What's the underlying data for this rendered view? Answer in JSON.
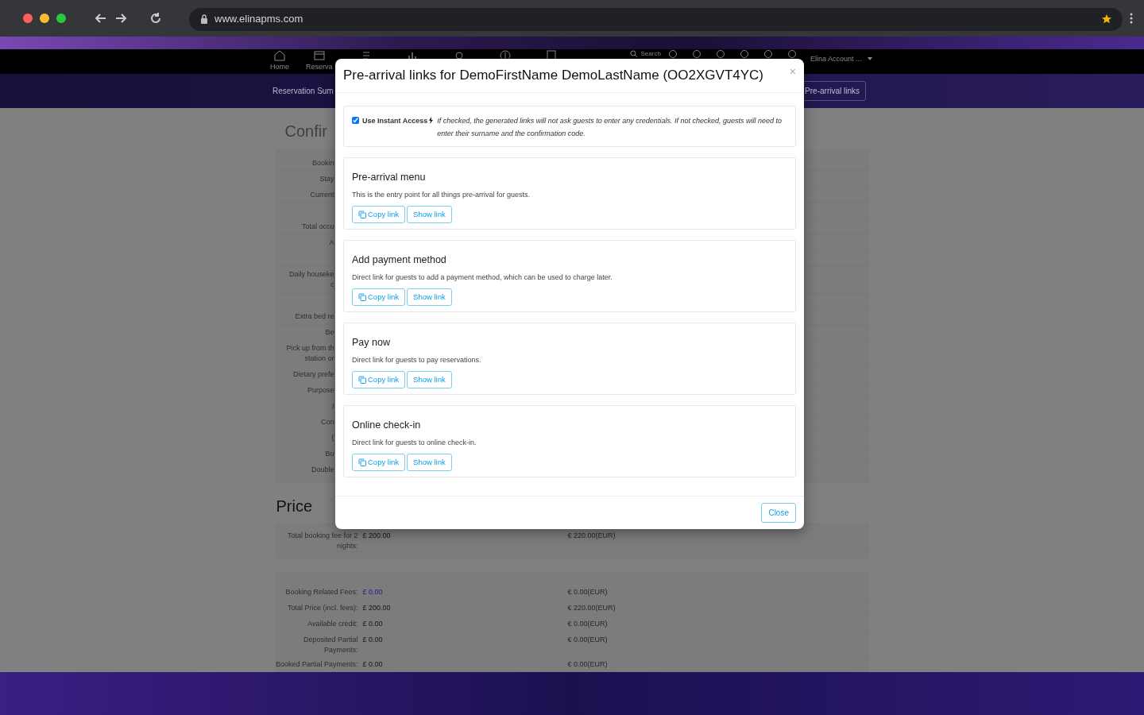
{
  "browser": {
    "url": "www.elinapms.com"
  },
  "navbar": {
    "items": [
      {
        "kind": "labeled",
        "label": "Home"
      },
      {
        "kind": "labeled",
        "label": "Reserva"
      },
      {
        "kind": "icon"
      },
      {
        "kind": "icon"
      },
      {
        "kind": "icon"
      },
      {
        "kind": "icon"
      },
      {
        "kind": "icon"
      }
    ],
    "search": {
      "placeholder": "Search"
    },
    "account": "Elina Account ..."
  },
  "subnav": {
    "title": "Reservation Sum",
    "button": "Pre-arrival links"
  },
  "confirmation": {
    "heading": "Confir",
    "rows": [
      {
        "kind": "label",
        "label": "Bookin"
      },
      {
        "kind": "label",
        "label": "Stay"
      },
      {
        "kind": "label",
        "label": "Current"
      },
      {
        "kind": "empty"
      },
      {
        "kind": "label",
        "label": "Total occu"
      },
      {
        "kind": "label",
        "label": "A"
      },
      {
        "kind": "empty"
      },
      {
        "kind": "label",
        "label": "Daily houseke\nc"
      },
      {
        "kind": "empty"
      },
      {
        "kind": "label",
        "label": "Extra bed re"
      },
      {
        "kind": "label",
        "label": "Be"
      },
      {
        "kind": "label",
        "label": "Pick up from th\nstation or"
      },
      {
        "kind": "label",
        "label": "Dietary prefe"
      },
      {
        "kind": "label",
        "label": "Purpose"
      },
      {
        "kind": "label",
        "label": "I"
      },
      {
        "kind": "label",
        "label": "Con"
      },
      {
        "kind": "label",
        "label": "("
      },
      {
        "kind": "label",
        "label": "Bu"
      },
      {
        "kind": "label",
        "label": "Double"
      }
    ]
  },
  "price": {
    "heading": "Price",
    "groups": [
      [
        {
          "label": "Total booking fee for 2 nights:",
          "gbp": "£ 200.00",
          "eur": "€ 220.00(EUR)",
          "linked": false
        }
      ],
      [
        {
          "label": "Booking Related Fees:",
          "gbp": "£ 0.00",
          "eur": "€ 0.00(EUR)",
          "linked": true
        },
        {
          "label": "Total Price (incl. fees):",
          "gbp": "£ 200.00",
          "eur": "€ 220.00(EUR)",
          "linked": false
        },
        {
          "label": "Available credit:",
          "gbp": "£ 0.00",
          "eur": "€ 0.00(EUR)",
          "linked": false
        },
        {
          "label": "Deposited Partial Payments:",
          "gbp": "£ 0.00",
          "eur": "€ 0.00(EUR)",
          "linked": false
        },
        {
          "label": "Booked Partial Payments:",
          "gbp": "£ 0.00",
          "eur": "€ 0.00(EUR)",
          "linked": false
        }
      ]
    ]
  },
  "modal": {
    "title": "Pre-arrival links for DemoFirstName DemoLastName (OO2XGVT4YC)",
    "close_symbol": "×",
    "instant_access": {
      "checked": true,
      "label": "Use Instant Access",
      "hint": "If checked, the generated links will not ask guests to enter any credentials. If not checked, guests will need to enter their surname and the confirmation code."
    },
    "sections": [
      {
        "title": "Pre-arrival menu",
        "description": "This is the entry point for all things pre-arrival for guests.",
        "copy": "Copy link",
        "show": "Show link"
      },
      {
        "title": "Add payment method",
        "description": "Direct link for guests to add a payment method, which can be used to charge later.",
        "copy": "Copy link",
        "show": "Show link"
      },
      {
        "title": "Pay now",
        "description": "Direct link for guests to pay reservations.",
        "copy": "Copy link",
        "show": "Show link"
      },
      {
        "title": "Online check-in",
        "description": "Direct link for guests to online check-in.",
        "copy": "Copy link",
        "show": "Show link"
      }
    ],
    "close_button": "Close"
  }
}
